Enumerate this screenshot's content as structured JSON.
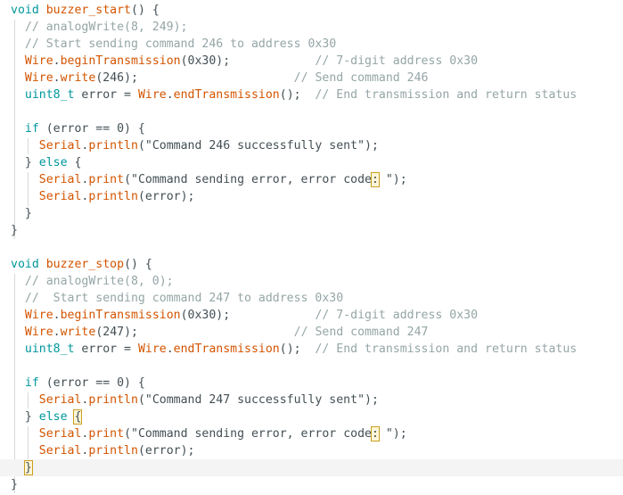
{
  "code": {
    "lines": [
      [
        {
          "t": "void",
          "c": "kw"
        },
        {
          "t": " "
        },
        {
          "t": "buzzer_start",
          "c": "fn"
        },
        {
          "t": "() {"
        }
      ],
      [
        {
          "t": "  "
        },
        {
          "t": "// analogWrite(8, 249);",
          "c": "cm"
        }
      ],
      [
        {
          "t": "  "
        },
        {
          "t": "// Start sending command 246 to address 0x30",
          "c": "cm"
        }
      ],
      [
        {
          "t": "  "
        },
        {
          "t": "Wire",
          "c": "fn"
        },
        {
          "t": "."
        },
        {
          "t": "beginTransmission",
          "c": "fn"
        },
        {
          "t": "(0x30);            "
        },
        {
          "t": "// 7-digit address 0x30",
          "c": "cm"
        }
      ],
      [
        {
          "t": "  "
        },
        {
          "t": "Wire",
          "c": "fn"
        },
        {
          "t": "."
        },
        {
          "t": "write",
          "c": "fn"
        },
        {
          "t": "(246);                      "
        },
        {
          "t": "// Send command 246",
          "c": "cm"
        }
      ],
      [
        {
          "t": "  "
        },
        {
          "t": "uint8_t",
          "c": "kw"
        },
        {
          "t": " error = "
        },
        {
          "t": "Wire",
          "c": "fn"
        },
        {
          "t": "."
        },
        {
          "t": "endTransmission",
          "c": "fn"
        },
        {
          "t": "();  "
        },
        {
          "t": "// End transmission and return status",
          "c": "cm"
        }
      ],
      [],
      [
        {
          "t": "  "
        },
        {
          "t": "if",
          "c": "kw"
        },
        {
          "t": " (error == 0) {"
        }
      ],
      [
        {
          "t": "    "
        },
        {
          "t": "Serial",
          "c": "fn"
        },
        {
          "t": "."
        },
        {
          "t": "println",
          "c": "fn"
        },
        {
          "t": "(\"Command 246 successfully sent\");"
        }
      ],
      [
        {
          "t": "  } "
        },
        {
          "t": "else",
          "c": "kw"
        },
        {
          "t": " {"
        }
      ],
      [
        {
          "t": "    "
        },
        {
          "t": "Serial",
          "c": "fn"
        },
        {
          "t": "."
        },
        {
          "t": "print",
          "c": "fn"
        },
        {
          "t": "(\"Command sending error, error code"
        },
        {
          "t": ":",
          "c": "match"
        },
        {
          "t": " \");"
        }
      ],
      [
        {
          "t": "    "
        },
        {
          "t": "Serial",
          "c": "fn"
        },
        {
          "t": "."
        },
        {
          "t": "println",
          "c": "fn"
        },
        {
          "t": "(error);"
        }
      ],
      [
        {
          "t": "  }"
        }
      ],
      [
        {
          "t": "}"
        }
      ],
      [],
      [
        {
          "t": "void",
          "c": "kw"
        },
        {
          "t": " "
        },
        {
          "t": "buzzer_stop",
          "c": "fn"
        },
        {
          "t": "() {"
        }
      ],
      [
        {
          "t": "  "
        },
        {
          "t": "// analogWrite(8, 0);",
          "c": "cm"
        }
      ],
      [
        {
          "t": "  "
        },
        {
          "t": "//  Start sending command 247 to address 0x30",
          "c": "cm"
        }
      ],
      [
        {
          "t": "  "
        },
        {
          "t": "Wire",
          "c": "fn"
        },
        {
          "t": "."
        },
        {
          "t": "beginTransmission",
          "c": "fn"
        },
        {
          "t": "(0x30);            "
        },
        {
          "t": "// 7-digit address 0x30",
          "c": "cm"
        }
      ],
      [
        {
          "t": "  "
        },
        {
          "t": "Wire",
          "c": "fn"
        },
        {
          "t": "."
        },
        {
          "t": "write",
          "c": "fn"
        },
        {
          "t": "(247);                      "
        },
        {
          "t": "// Send command 247",
          "c": "cm"
        }
      ],
      [
        {
          "t": "  "
        },
        {
          "t": "uint8_t",
          "c": "kw"
        },
        {
          "t": " error = "
        },
        {
          "t": "Wire",
          "c": "fn"
        },
        {
          "t": "."
        },
        {
          "t": "endTransmission",
          "c": "fn"
        },
        {
          "t": "();  "
        },
        {
          "t": "// End transmission and return status",
          "c": "cm"
        }
      ],
      [],
      [
        {
          "t": "  "
        },
        {
          "t": "if",
          "c": "kw"
        },
        {
          "t": " (error == 0) {"
        }
      ],
      [
        {
          "t": "    "
        },
        {
          "t": "Serial",
          "c": "fn"
        },
        {
          "t": "."
        },
        {
          "t": "println",
          "c": "fn"
        },
        {
          "t": "(\"Command 247 successfully sent\");"
        }
      ],
      [
        {
          "t": "  } "
        },
        {
          "t": "else",
          "c": "kw"
        },
        {
          "t": " "
        },
        {
          "t": "{",
          "c": "match"
        }
      ],
      [
        {
          "t": "    "
        },
        {
          "t": "Serial",
          "c": "fn"
        },
        {
          "t": "."
        },
        {
          "t": "print",
          "c": "fn"
        },
        {
          "t": "(\"Command sending error, error code"
        },
        {
          "t": ":",
          "c": "match"
        },
        {
          "t": " \");"
        }
      ],
      [
        {
          "t": "    "
        },
        {
          "t": "Serial",
          "c": "fn"
        },
        {
          "t": "."
        },
        {
          "t": "println",
          "c": "fn"
        },
        {
          "t": "(error);"
        }
      ],
      [
        {
          "t": "  "
        },
        {
          "t": "}",
          "c": "match"
        }
      ],
      [
        {
          "t": "}"
        }
      ]
    ],
    "current_line_index": 27
  },
  "colors": {
    "keyword": "#00979c",
    "function": "#d35400",
    "comment": "#95a5a6",
    "text": "#434f54",
    "bracket_match_outline": "#c9a020",
    "current_line_bg": "#f4f4f4"
  }
}
